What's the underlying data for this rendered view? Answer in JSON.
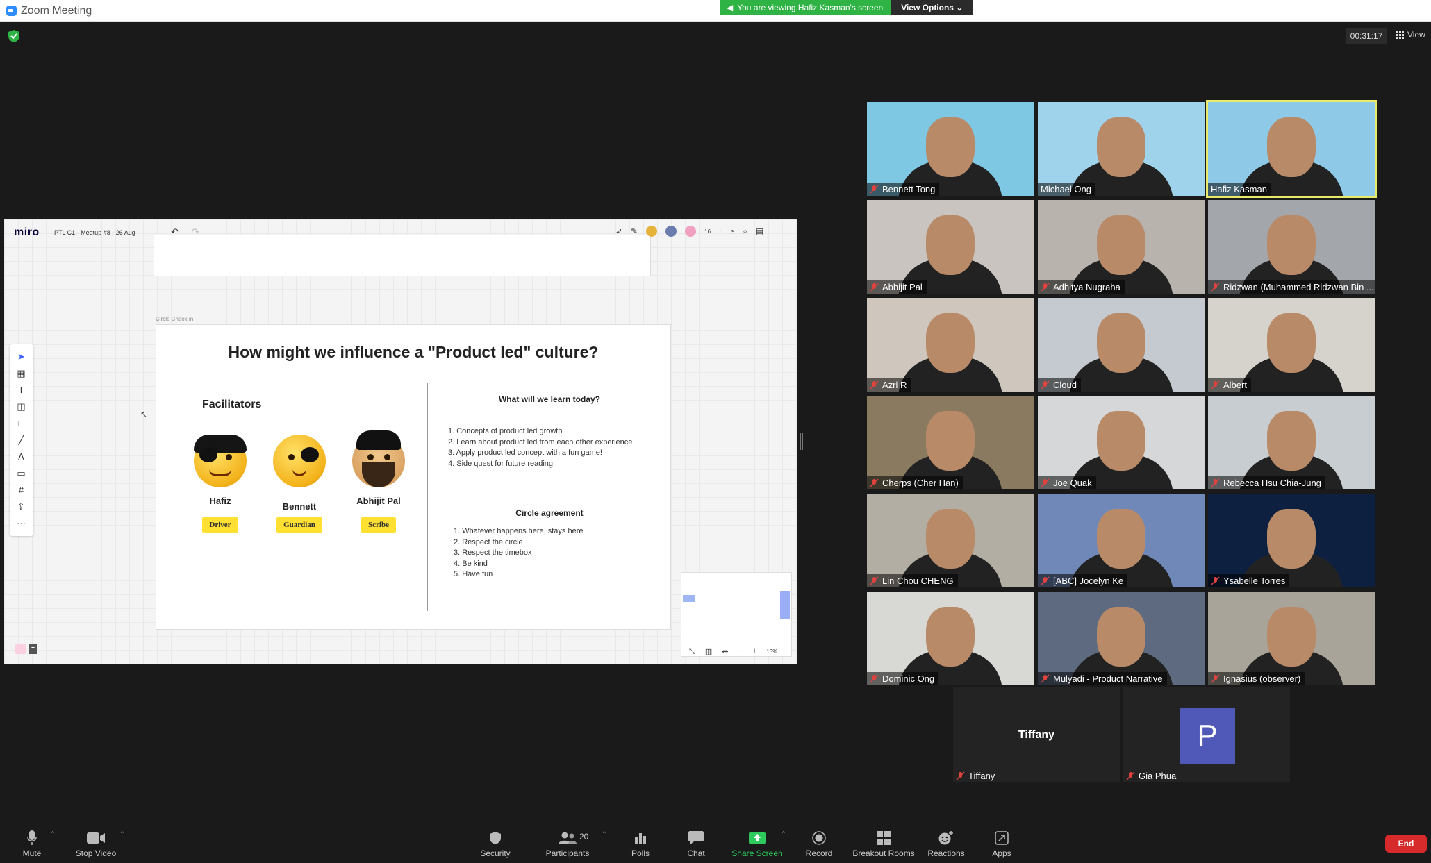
{
  "window": {
    "title": "Zoom Meeting"
  },
  "banner": {
    "viewing": "You are viewing Hafiz Kasman's screen",
    "view_options": "View Options"
  },
  "timer": "00:31:17",
  "view_label": "View",
  "miro": {
    "logo": "miro",
    "board_name": "PTL C1 - Meetup #8 - 26 Aug",
    "collaborators": "16",
    "frame_label": "Circle Check-in",
    "question": "How might we influence a \"Product led\" culture?",
    "facilitators_heading": "Facilitators",
    "facilitators": [
      {
        "name": "Hafiz",
        "role": "Driver"
      },
      {
        "name": "Bennett",
        "role": "Guardian"
      },
      {
        "name": "Abhijit Pal",
        "role": "Scribe"
      }
    ],
    "learn_heading": "What will we learn today?",
    "learn_items": [
      "1. Concepts of product led growth",
      "2. Learn about product led from each other experience",
      "3. Apply product led concept with a fun game!",
      "4. Side quest for future reading"
    ],
    "agreement_heading": "Circle agreement",
    "agreement_items": [
      "1. Whatever happens here, stays here",
      "2. Respect the circle",
      "3. Respect the timebox",
      "4. Be kind",
      "5. Have fun"
    ],
    "zoom": "13%"
  },
  "participants": [
    {
      "name": "Bennett Tong",
      "bg": "#7ec8e3"
    },
    {
      "name": "Michael Ong",
      "bg": "#9fd3ec"
    },
    {
      "name": "Hafiz Kasman",
      "bg": "#8fc9e8"
    },
    {
      "name": "Abhijit Pal",
      "bg": "#c9c4bf"
    },
    {
      "name": "Adhitya Nugraha",
      "bg": "#b8b3ad"
    },
    {
      "name": "Ridzwan (Muhammed Ridzwan Bin ...",
      "bg": "#a3a6ab"
    },
    {
      "name": "Azri R",
      "bg": "#cfc7bd"
    },
    {
      "name": "Cloud",
      "bg": "#c4cad0"
    },
    {
      "name": "Albert",
      "bg": "#d6d3cc"
    },
    {
      "name": "Cherps (Cher Han)",
      "bg": "#8a7a60"
    },
    {
      "name": "Joe Quak",
      "bg": "#d5d7d8"
    },
    {
      "name": "Rebecca Hsu Chia-Jung",
      "bg": "#c7cdd1"
    },
    {
      "name": "Lin Chou CHENG",
      "bg": "#b3aea4"
    },
    {
      "name": "[ABC] Jocelyn Ke",
      "bg": "#6f88b8"
    },
    {
      "name": "Ysabelle Torres",
      "bg": "#0d2040"
    },
    {
      "name": "Dominic Ong",
      "bg": "#d8d8d4"
    },
    {
      "name": "Mulyadi - Product Narrative",
      "bg": "#5d6a80"
    },
    {
      "name": "Ignasius (observer)",
      "bg": "#a9a49a"
    }
  ],
  "tiffany": {
    "big": "Tiffany",
    "name": "Tiffany"
  },
  "gia": {
    "initial": "P",
    "name": "Gia Phua"
  },
  "controls": {
    "mute": "Mute",
    "stop_video": "Stop Video",
    "security": "Security",
    "participants": "Participants",
    "participants_count": "20",
    "polls": "Polls",
    "chat": "Chat",
    "share_screen": "Share Screen",
    "record": "Record",
    "breakout_rooms": "Breakout Rooms",
    "reactions": "Reactions",
    "apps": "Apps",
    "end": "End"
  }
}
